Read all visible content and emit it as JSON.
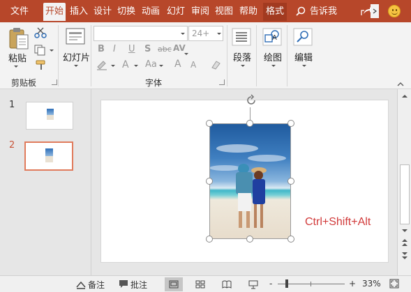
{
  "tabs": [
    {
      "label": "文件"
    },
    {
      "label": "开始"
    },
    {
      "label": "插入"
    },
    {
      "label": "设计"
    },
    {
      "label": "切换"
    },
    {
      "label": "动画"
    },
    {
      "label": "幻灯"
    },
    {
      "label": "审阅"
    },
    {
      "label": "视图"
    },
    {
      "label": "帮助"
    },
    {
      "label": "格式"
    }
  ],
  "active_tab": "开始",
  "tell_me": "告诉我",
  "ribbon": {
    "paste": "粘贴",
    "clipboard_group": "剪贴板",
    "slides_button": "幻灯片",
    "font_group": "字体",
    "font_size_placeholder": "24+",
    "paragraph": "段落",
    "drawing": "绘图",
    "editing": "编辑",
    "format_glyphs": {
      "bold": "B",
      "italic": "I",
      "underline": "U",
      "shadow": "S",
      "strike": "abc",
      "spacing": "AV",
      "case": "Aa",
      "font_color": "A",
      "grow": "A",
      "shrink": "A"
    }
  },
  "thumbnails": [
    {
      "number": "1",
      "selected": false
    },
    {
      "number": "2",
      "selected": true
    }
  ],
  "slide": {
    "caption": "Ctrl+Shift+Alt"
  },
  "status": {
    "notes": "备注",
    "comments": "批注",
    "zoom_minus": "-",
    "zoom_plus": "+",
    "zoom_level": "33%"
  },
  "colors": {
    "accent": "#b7472a",
    "caption": "#d13a3a",
    "thumb_selected_border": "#e07b5c"
  }
}
